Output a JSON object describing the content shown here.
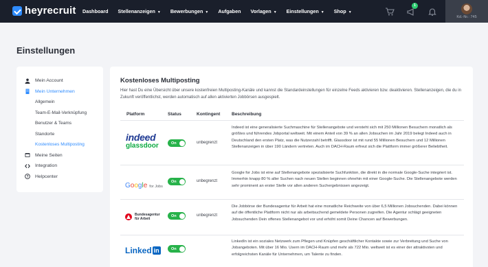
{
  "header": {
    "brand": "heyrecruit",
    "nav": [
      {
        "label": "Dashboard",
        "caret": false
      },
      {
        "label": "Stellenanzeigen",
        "caret": true
      },
      {
        "label": "Bewerbungen",
        "caret": true
      },
      {
        "label": "Aufgaben",
        "caret": false
      },
      {
        "label": "Vorlagen",
        "caret": true
      },
      {
        "label": "Einstellungen",
        "caret": true
      },
      {
        "label": "Shop",
        "caret": true
      }
    ],
    "icons": [
      "cart-icon",
      "megaphone-icon",
      "bell-icon"
    ],
    "notification_count": "1",
    "customer_number": "Kd.-Nr.: 745"
  },
  "page": {
    "title": "Einstellungen"
  },
  "sidebar": {
    "items": [
      {
        "label": "Mein Account",
        "icon": "user-icon",
        "active": false
      },
      {
        "label": "Mein Unternehmen",
        "icon": "building-icon",
        "active": true
      },
      {
        "label": "Allgemein",
        "sub": true
      },
      {
        "label": "Team-E-Mail-Verknüpfung",
        "sub": true
      },
      {
        "label": "Benutzer & Teams",
        "sub": true
      },
      {
        "label": "Standorte",
        "sub": true
      },
      {
        "label": "Kostenloses Multiposting",
        "sub": true,
        "active": true
      },
      {
        "label": "Meine Seiten",
        "icon": "window-icon",
        "active": false
      },
      {
        "label": "Integration",
        "icon": "code-icon",
        "active": false
      },
      {
        "label": "Helpcenter",
        "icon": "help-icon",
        "active": false
      }
    ]
  },
  "main": {
    "title": "Kostenloses Multiposting",
    "description": "Hier hast Du eine Übersicht über unsere kostenfreien Multiposting-Kanäle und kannst die Standardeinstellungen für einzelne Feeds aktivieren bzw. deaktivieren. Stellenanzeigen, die du in Zukunft veröffentlichst, werden automatisch auf allen aktivierten Jobbörsen ausgespielt.",
    "columns": [
      "Platform",
      "Status",
      "Kontingent",
      "Beschreibung"
    ],
    "rows": [
      {
        "platform": "indeed glassdoor",
        "logo_main": "indeed",
        "logo_sub": "glassdoor",
        "status": "On",
        "kontingent": "unbegrenzt",
        "description": "Indeed ist eine generalisierte Suchmaschine für Stellenangebote und versteht sich mit 250 Millionen Besuchern monatlich als größtes und führendes Jobportal weltweit. Mit einem Anteil von 39 % an allen Jobsuchen im Jahr 2019 belegt Indeed auch in Deutschland den ersten Platz, was die Nutzerzahl betrifft. Glassdoor ist mit rund 55 Millionen Besuchern und 12 Millionen Stellenanzeigen in über 190 Ländern vertreten. Auch im DACH-Raum erfreut sich die Plattform immer größerer Beliebtheit."
      },
      {
        "platform": "Google for Jobs",
        "logo_sub": "for Jobs",
        "status": "On",
        "kontingent": "unbegrenzt",
        "description": "Google for Jobs ist eine auf Stellenangebote spezialisierte Suchfunktion, die direkt in die normale Google-Suche integriert ist. Immerhin knapp 80 % aller Suchen nach neuen Stellen beginnen ohnehin mit einer Google-Suche. Die Stellenangebote werden sehr prominent an erster Stelle vor allen anderen Suchergebnissen angezeigt."
      },
      {
        "platform": "Bundesagentur für Arbeit",
        "logo_line1": "Bundesagentur",
        "logo_line2": "für Arbeit",
        "status": "On",
        "kontingent": "unbegrenzt",
        "description": "Die Jobbörse der Bundesagentur für Arbeit hat eine monatliche Reichweite von über 6,5 Millionen Jobsuchenden. Dabei können auf die öffentliche Plattform nicht nur als arbeitsuchend gemeldete Personen zugreifen. Die Agentur schlägt geeigneten Jobsuchenden Dein offenes Stellenangebot vor und erhöht somit Deine Chancen auf Bewerbungen."
      },
      {
        "platform": "LinkedIn",
        "logo_main": "Linked",
        "logo_sub": "in",
        "status": "On",
        "kontingent": "",
        "description": "LinkedIn ist ein soziales Netzwerk zum Pflegen und Knüpfen geschäftlicher Kontakte sowie zur Verbreitung und Suche von Jobangeboten. Mit über 16 Mio. Usern im DACH-Raum und mehr als 722 Mio. weltweit ist es einer der attraktivsten und erfolgreichsten Kanäle für Unternehmen, um Talente zu finden."
      }
    ]
  }
}
